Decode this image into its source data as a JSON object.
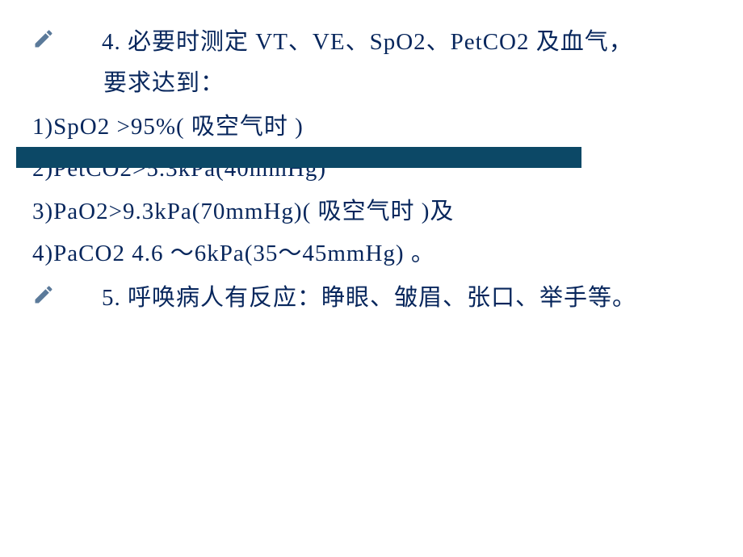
{
  "item4": {
    "bullet_text": "4. 必要时测定 VT、VE、SpO2、PetCO2 及血气，",
    "continue": "要求达到："
  },
  "sub1": "1)SpO2 >95%( 吸空气时 )",
  "sub2": "2)PetCO2>5.3kPa(40mmHg)",
  "sub3": "3)PaO2>9.3kPa(70mmHg)( 吸空气时 )及",
  "sub4": "4)PaCO2 4.6 ～6kPa(35～45mmHg) 。",
  "item5": {
    "bullet_text": "5. 呼唤病人有反应：睁眼、皱眉、张口、举手等。"
  }
}
